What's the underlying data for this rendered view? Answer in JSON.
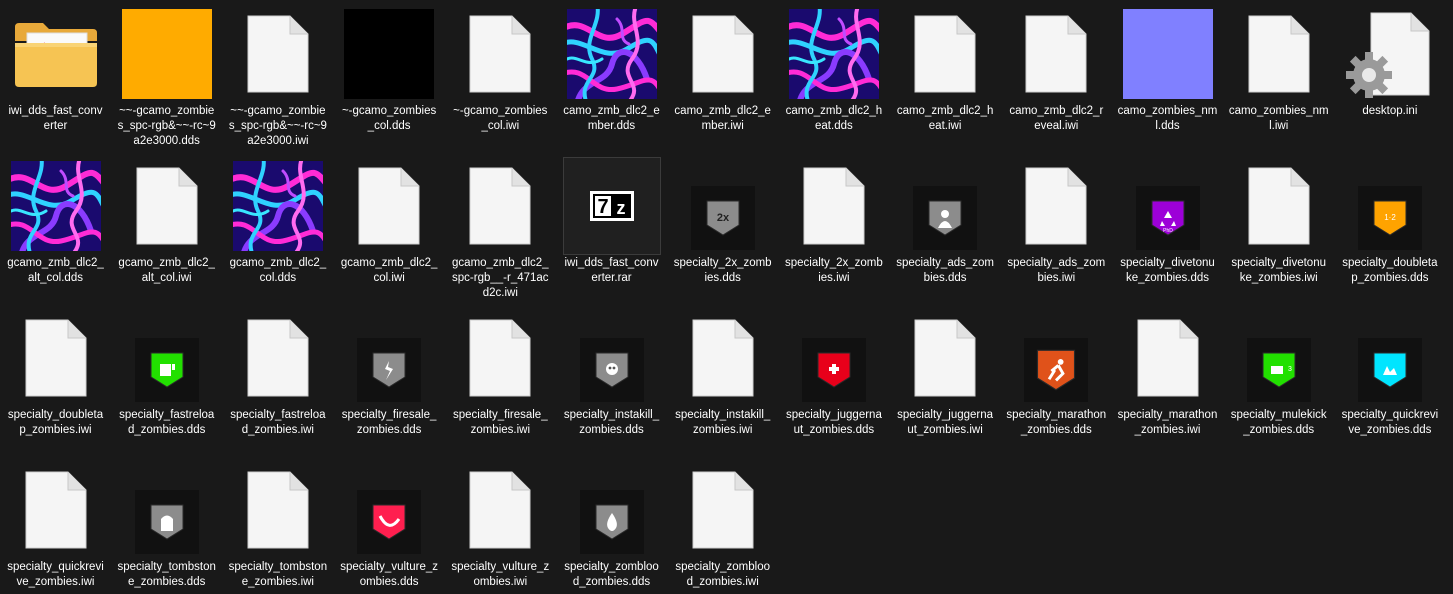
{
  "files": [
    {
      "name": "iwi_dds_fast_converter",
      "icon": "folder-icon"
    },
    {
      "name": "~~-gcamo_zombies_spc-rgb&~~-rc~9a2e3000.dds",
      "icon": "orange-square-thumbnail",
      "color": "#ffab00"
    },
    {
      "name": "~~-gcamo_zombies_spc-rgb&~~-rc~9a2e3000.iwi",
      "icon": "blank-file-icon"
    },
    {
      "name": "~-gcamo_zombies_col.dds",
      "icon": "black-square-thumbnail",
      "color": "#000000"
    },
    {
      "name": "~-gcamo_zombies_col.iwi",
      "icon": "blank-file-icon"
    },
    {
      "name": "camo_zmb_dlc2_ember.dds",
      "icon": "neon-swirl-thumbnail"
    },
    {
      "name": "camo_zmb_dlc2_ember.iwi",
      "icon": "blank-file-icon"
    },
    {
      "name": "camo_zmb_dlc2_heat.dds",
      "icon": "neon-swirl-thumbnail"
    },
    {
      "name": "camo_zmb_dlc2_heat.iwi",
      "icon": "blank-file-icon"
    },
    {
      "name": "camo_zmb_dlc2_reveal.iwi",
      "icon": "blank-file-icon"
    },
    {
      "name": "camo_zombies_nml.dds",
      "icon": "lavender-square-thumbnail",
      "color": "#8080ff"
    },
    {
      "name": "camo_zombies_nml.iwi",
      "icon": "blank-file-icon"
    },
    {
      "name": "desktop.ini",
      "icon": "settings-file-icon"
    },
    {
      "name": "gcamo_zmb_dlc2_alt_col.dds",
      "icon": "neon-swirl-thumbnail"
    },
    {
      "name": "gcamo_zmb_dlc2_alt_col.iwi",
      "icon": "blank-file-icon"
    },
    {
      "name": "gcamo_zmb_dlc2_col.dds",
      "icon": "neon-swirl-thumbnail"
    },
    {
      "name": "gcamo_zmb_dlc2_col.iwi",
      "icon": "blank-file-icon"
    },
    {
      "name": "gcamo_zmb_dlc2_spc-rgb__-r_471acd2c.iwi",
      "icon": "blank-file-icon"
    },
    {
      "name": "iwi_dds_fast_converter.rar",
      "icon": "7z-archive-icon",
      "selected": true
    },
    {
      "name": "specialty_2x_zombies.dds",
      "icon": "perk-shield-icon",
      "color": "#8c8c8c",
      "glyph": "2x"
    },
    {
      "name": "specialty_2x_zombies.iwi",
      "icon": "blank-file-icon"
    },
    {
      "name": "specialty_ads_zombies.dds",
      "icon": "perk-shield-icon",
      "color": "#8c8c8c",
      "glyph": "ads"
    },
    {
      "name": "specialty_ads_zombies.iwi",
      "icon": "blank-file-icon"
    },
    {
      "name": "specialty_divetonuke_zombies.dds",
      "icon": "perk-shield-icon",
      "color": "#9d00d8",
      "glyph": "nuke"
    },
    {
      "name": "specialty_divetonuke_zombies.iwi",
      "icon": "blank-file-icon"
    },
    {
      "name": "specialty_doubletap_zombies.dds",
      "icon": "perk-shield-icon",
      "color": "#ffa300",
      "glyph": "1 2"
    },
    {
      "name": "specialty_doubletap_zombies.iwi",
      "icon": "blank-file-icon"
    },
    {
      "name": "specialty_fastreload_zombies.dds",
      "icon": "perk-shield-icon",
      "color": "#22e000",
      "glyph": "reload"
    },
    {
      "name": "specialty_fastreload_zombies.iwi",
      "icon": "blank-file-icon"
    },
    {
      "name": "specialty_firesale_zombies.dds",
      "icon": "perk-shield-icon",
      "color": "#8c8c8c",
      "glyph": "fire"
    },
    {
      "name": "specialty_firesale_zombies.iwi",
      "icon": "blank-file-icon"
    },
    {
      "name": "specialty_instakill_zombies.dds",
      "icon": "perk-shield-icon",
      "color": "#8c8c8c",
      "glyph": "skull"
    },
    {
      "name": "specialty_instakill_zombies.iwi",
      "icon": "blank-file-icon"
    },
    {
      "name": "specialty_juggernaut_zombies.dds",
      "icon": "perk-shield-icon",
      "color": "#e8001a",
      "glyph": "jugg"
    },
    {
      "name": "specialty_juggernaut_zombies.iwi",
      "icon": "blank-file-icon"
    },
    {
      "name": "specialty_marathon_zombies.dds",
      "icon": "perk-shield-icon",
      "color": "#e0521a",
      "glyph": "run"
    },
    {
      "name": "specialty_marathon_zombies.iwi",
      "icon": "blank-file-icon"
    },
    {
      "name": "specialty_mulekick_zombies.dds",
      "icon": "perk-shield-icon",
      "color": "#22e000",
      "glyph": "x3"
    },
    {
      "name": "specialty_quickrevive_zombies.dds",
      "icon": "perk-shield-icon",
      "color": "#00e5ff",
      "glyph": "revive"
    },
    {
      "name": "specialty_quickrevive_zombies.iwi",
      "icon": "blank-file-icon"
    },
    {
      "name": "specialty_tombstone_zombies.dds",
      "icon": "perk-shield-icon",
      "color": "#8c8c8c",
      "glyph": "tomb"
    },
    {
      "name": "specialty_tombstone_zombies.iwi",
      "icon": "blank-file-icon"
    },
    {
      "name": "specialty_vulture_zombies.dds",
      "icon": "perk-shield-icon",
      "color": "#ff1f4f",
      "glyph": "vulture"
    },
    {
      "name": "specialty_vulture_zombies.iwi",
      "icon": "blank-file-icon"
    },
    {
      "name": "specialty_zomblood_zombies.dds",
      "icon": "perk-shield-icon",
      "color": "#8c8c8c",
      "glyph": "drop"
    },
    {
      "name": "specialty_zomblood_zombies.iwi",
      "icon": "blank-file-icon"
    }
  ]
}
